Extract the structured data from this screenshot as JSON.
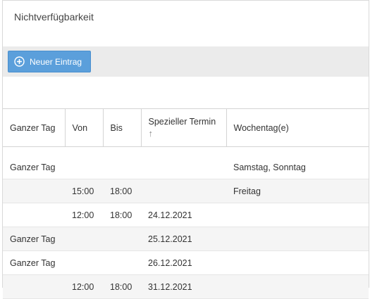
{
  "panel": {
    "title": "Nichtverfügbarkeit"
  },
  "toolbar": {
    "new_entry_label": "Neuer Eintrag",
    "new_entry_icon": "plus-circle-icon",
    "accent_color": "#5b9fdb"
  },
  "table": {
    "columns": {
      "whole_day": "Ganzer Tag",
      "from": "Von",
      "to": "Bis",
      "special_date": "Spezieller Termin",
      "weekday": "Wochentag(e)"
    },
    "sort_indicator": "↑",
    "rows": [
      {
        "whole_day": "Ganzer Tag",
        "from": "",
        "to": "",
        "special_date": "",
        "weekday": "Samstag, Sonntag"
      },
      {
        "whole_day": "",
        "from": "15:00",
        "to": "18:00",
        "special_date": "",
        "weekday": "Freitag"
      },
      {
        "whole_day": "",
        "from": "12:00",
        "to": "18:00",
        "special_date": "24.12.2021",
        "weekday": ""
      },
      {
        "whole_day": "Ganzer Tag",
        "from": "",
        "to": "",
        "special_date": "25.12.2021",
        "weekday": ""
      },
      {
        "whole_day": "Ganzer Tag",
        "from": "",
        "to": "",
        "special_date": "26.12.2021",
        "weekday": ""
      },
      {
        "whole_day": "",
        "from": "12:00",
        "to": "18:00",
        "special_date": "31.12.2021",
        "weekday": ""
      }
    ]
  }
}
